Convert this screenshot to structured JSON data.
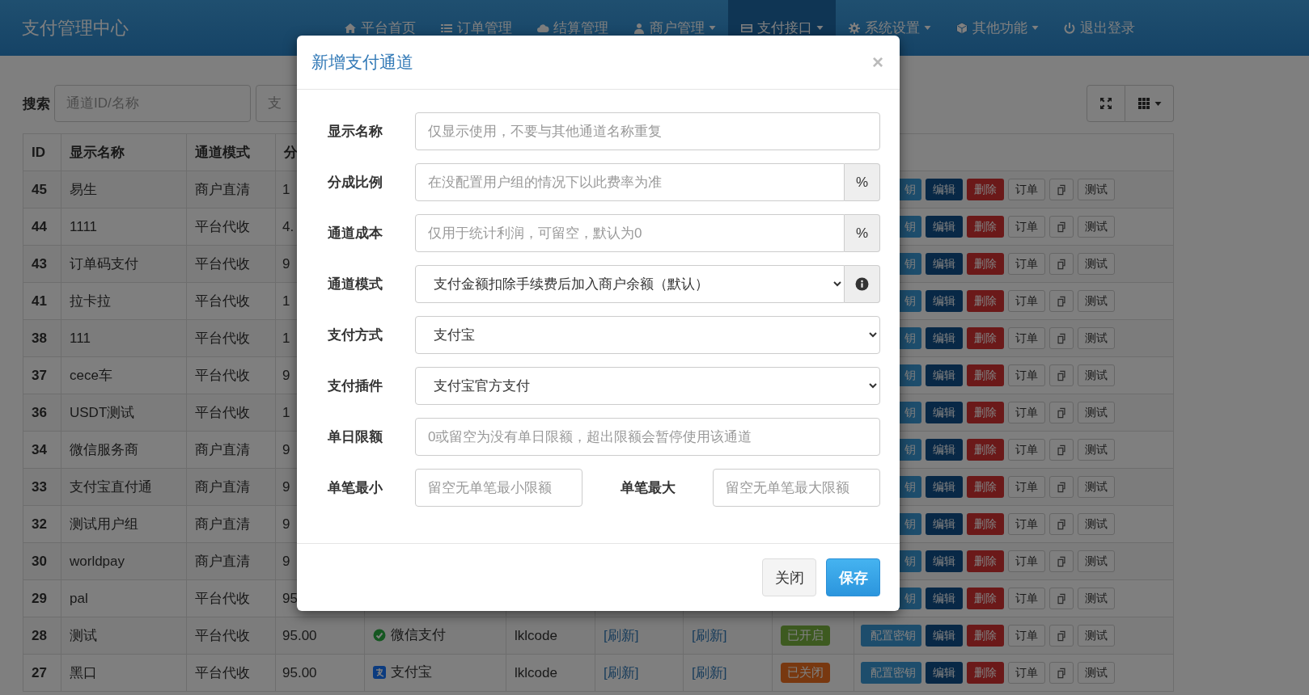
{
  "brand": "支付管理中心",
  "nav": [
    {
      "label": "平台首页",
      "caret": false,
      "selected": false
    },
    {
      "label": "订单管理",
      "caret": false,
      "selected": false
    },
    {
      "label": "结算管理",
      "caret": false,
      "selected": false
    },
    {
      "label": "商户管理",
      "caret": true,
      "selected": false
    },
    {
      "label": "支付接口",
      "caret": true,
      "selected": true
    },
    {
      "label": "系统设置",
      "caret": true,
      "selected": false
    },
    {
      "label": "其他功能",
      "caret": true,
      "selected": false
    },
    {
      "label": "退出登录",
      "caret": false,
      "selected": false
    }
  ],
  "search": {
    "label": "搜索",
    "fields": [
      {
        "placeholder": "通道ID/名称"
      },
      {
        "placeholder": "支"
      }
    ]
  },
  "table": {
    "columns": [
      "ID",
      "显示名称",
      "通道模式",
      "分"
    ],
    "rows": [
      {
        "id": "45",
        "name": "易生",
        "mode": "商户直清",
        "rate": "1",
        "key": "钥",
        "edit": "编辑",
        "delete": "删除",
        "orders": "订单",
        "test": "测试"
      },
      {
        "id": "44",
        "name": "1111",
        "mode": "平台代收",
        "rate": "4.",
        "key": "钥",
        "edit": "编辑",
        "delete": "删除",
        "orders": "订单",
        "test": "测试"
      },
      {
        "id": "43",
        "name": "订单码支付",
        "mode": "平台代收",
        "rate": "9",
        "key": "钥",
        "edit": "编辑",
        "delete": "删除",
        "orders": "订单",
        "test": "测试"
      },
      {
        "id": "41",
        "name": "拉卡拉",
        "mode": "平台代收",
        "rate": "1",
        "key": "钥",
        "edit": "编辑",
        "delete": "删除",
        "orders": "订单",
        "test": "测试"
      },
      {
        "id": "38",
        "name": "111",
        "mode": "平台代收",
        "rate": "1",
        "key": "钥",
        "edit": "编辑",
        "delete": "删除",
        "orders": "订单",
        "test": "测试"
      },
      {
        "id": "37",
        "name": "cece车",
        "mode": "平台代收",
        "rate": "9",
        "key": "钥",
        "edit": "编辑",
        "delete": "删除",
        "orders": "订单",
        "test": "测试"
      },
      {
        "id": "36",
        "name": "USDT测试",
        "mode": "平台代收",
        "rate": "1",
        "key": "钥",
        "edit": "编辑",
        "delete": "删除",
        "orders": "订单",
        "test": "测试"
      },
      {
        "id": "34",
        "name": "微信服务商",
        "mode": "商户直清",
        "rate": "9",
        "key": "钥",
        "edit": "编辑",
        "delete": "删除",
        "orders": "订单",
        "test": "测试"
      },
      {
        "id": "33",
        "name": "支付宝直付通",
        "mode": "商户直清",
        "rate": "9",
        "key": "钥",
        "edit": "编辑",
        "delete": "删除",
        "orders": "订单",
        "test": "测试"
      },
      {
        "id": "32",
        "name": "测试用户组",
        "mode": "商户直清",
        "rate": "9",
        "key": "钥",
        "edit": "编辑",
        "delete": "删除",
        "orders": "订单",
        "test": "测试"
      },
      {
        "id": "30",
        "name": "worldpay",
        "mode": "商户直清",
        "rate": "9",
        "key": "钥",
        "edit": "编辑",
        "delete": "删除",
        "orders": "订单",
        "test": "测试"
      },
      {
        "id": "29",
        "name": "pal",
        "mode": "平台代收",
        "rate": "95",
        "key": "钥",
        "edit": "编辑",
        "delete": "删除",
        "orders": "订单",
        "test": "测试"
      },
      {
        "id": "28",
        "name": "测试",
        "mode": "平台代收",
        "rate": "95.00",
        "pay": {
          "label": "微信支付",
          "kind": "check"
        },
        "plugin": "lklcode",
        "link1": "[刷新]",
        "link2": "[刷新]",
        "status": {
          "label": "已开启",
          "on": true
        },
        "key": "配置密钥",
        "edit": "编辑",
        "delete": "删除",
        "orders": "订单",
        "test": "测试"
      },
      {
        "id": "27",
        "name": "黑口",
        "mode": "平台代收",
        "rate": "95.00",
        "pay": {
          "label": "支付宝",
          "kind": "square"
        },
        "plugin": "lklcode",
        "link1": "[刷新]",
        "link2": "[刷新]",
        "status": {
          "label": "已关闭",
          "on": false
        },
        "key": "配置密钥",
        "edit": "编辑",
        "delete": "删除",
        "orders": "订单",
        "test": "测试"
      }
    ]
  },
  "modal": {
    "title": "新增支付通道",
    "close": "×",
    "fields": [
      {
        "kind": "text",
        "label": "显示名称",
        "placeholder": "仅显示使用，不要与其他通道名称重复"
      },
      {
        "kind": "addon",
        "label": "分成比例",
        "placeholder": "在没配置用户组的情况下以此费率为准",
        "addon": "%"
      },
      {
        "kind": "addon",
        "label": "通道成本",
        "placeholder": "仅用于统计利润，可留空，默认为0",
        "addon": "%"
      },
      {
        "kind": "select_info",
        "label": "通道模式",
        "value": "支付金额扣除手续费后加入商户余额（默认）"
      },
      {
        "kind": "select",
        "label": "支付方式",
        "value": "支付宝"
      },
      {
        "kind": "select",
        "label": "支付插件",
        "value": "支付宝官方支付"
      },
      {
        "kind": "text",
        "label": "单日限额",
        "placeholder": "0或留空为没有单日限额，超出限额会暂停使用该通道"
      },
      {
        "kind": "pair",
        "label": "单笔最小",
        "placeholder": "留空无单笔最小限额",
        "label2": "单笔最大",
        "placeholder2": "留空无单笔最大限额"
      }
    ],
    "buttons": {
      "cancel": "关闭",
      "save": "保存"
    }
  }
}
